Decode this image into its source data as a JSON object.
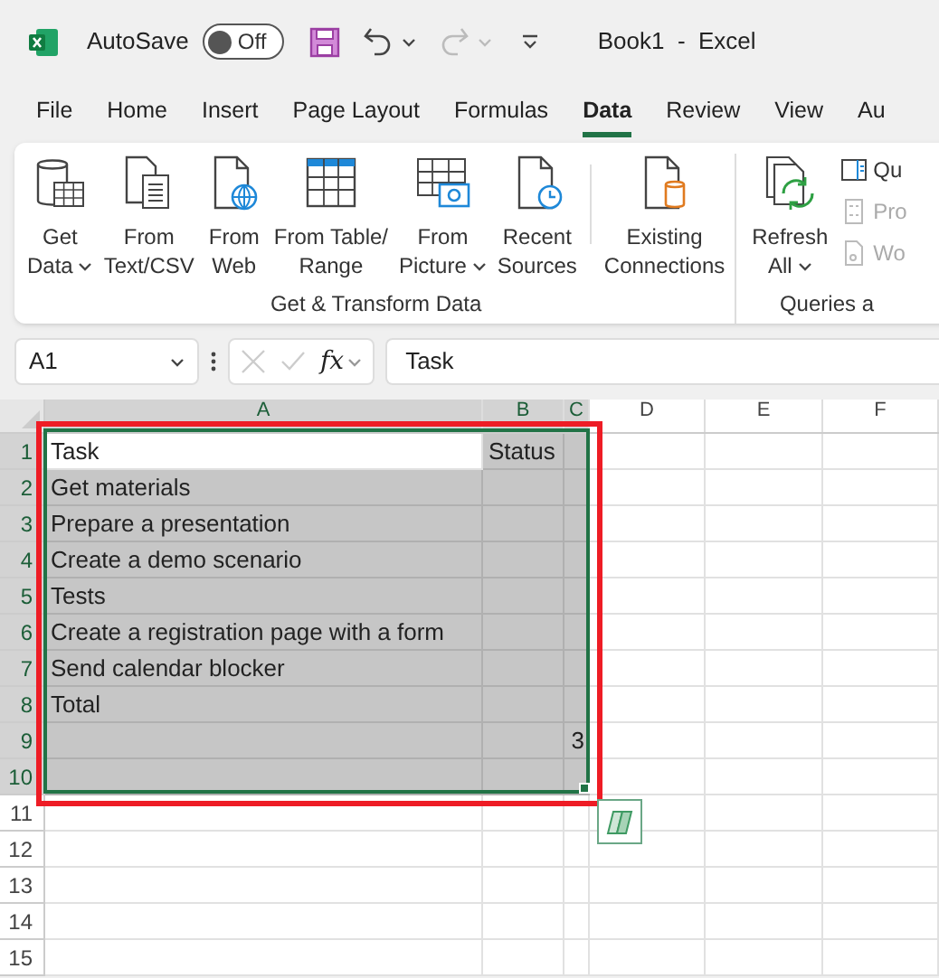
{
  "title_bar": {
    "autosave_label": "AutoSave",
    "autosave_toggle": {
      "label": "Off",
      "on": false
    },
    "title": "Book1  -  Excel"
  },
  "tabs": [
    {
      "label": "File",
      "selected": false
    },
    {
      "label": "Home",
      "selected": false
    },
    {
      "label": "Insert",
      "selected": false
    },
    {
      "label": "Page Layout",
      "selected": false
    },
    {
      "label": "Formulas",
      "selected": false
    },
    {
      "label": "Data",
      "selected": true
    },
    {
      "label": "Review",
      "selected": false
    },
    {
      "label": "View",
      "selected": false
    },
    {
      "label": "Au",
      "selected": false
    }
  ],
  "ribbon": {
    "groups": [
      {
        "label": "Get & Transform Data",
        "buttons": [
          {
            "kind": "get-data",
            "lines": [
              "Get",
              "Data"
            ],
            "dropdown": true
          },
          {
            "kind": "text-csv",
            "lines": [
              "From",
              "Text/CSV"
            ],
            "dropdown": false
          },
          {
            "kind": "web",
            "lines": [
              "From",
              "Web"
            ],
            "dropdown": false
          },
          {
            "kind": "table",
            "lines": [
              "From Table/",
              "Range"
            ],
            "dropdown": false
          },
          {
            "kind": "picture",
            "lines": [
              "From",
              "Picture"
            ],
            "dropdown": true
          },
          {
            "kind": "recent",
            "lines": [
              "Recent",
              "Sources"
            ],
            "dropdown": false
          },
          {
            "kind": "connections",
            "lines": [
              "Existing",
              "Connections"
            ],
            "dropdown": false
          }
        ]
      },
      {
        "label": "Queries a",
        "buttons": [
          {
            "kind": "refresh",
            "lines": [
              "Refresh",
              "All"
            ],
            "dropdown": true
          }
        ],
        "small_items": [
          {
            "kind": "queries",
            "label": "Qu",
            "disabled": false
          },
          {
            "kind": "properties",
            "label": "Pro",
            "disabled": true
          },
          {
            "kind": "links",
            "label": "Wo",
            "disabled": true
          }
        ]
      }
    ]
  },
  "formula_bar": {
    "name_box": "A1",
    "fx": "fx",
    "value": "Task"
  },
  "sheet": {
    "columns": [
      {
        "label": "A",
        "selected": true
      },
      {
        "label": "B",
        "selected": true
      },
      {
        "label": "C",
        "selected": true
      },
      {
        "label": "D",
        "selected": false
      },
      {
        "label": "E",
        "selected": false
      },
      {
        "label": "F",
        "selected": false
      }
    ],
    "rows": [
      {
        "number": "1",
        "selected": true,
        "cells": [
          {
            "text": "Task",
            "active": true
          },
          {
            "text": "Status"
          },
          {}
        ]
      },
      {
        "number": "2",
        "selected": true,
        "cells": [
          {
            "text": "Get materials"
          },
          {},
          {}
        ]
      },
      {
        "number": "3",
        "selected": true,
        "cells": [
          {
            "text": "Prepare a presentation"
          },
          {},
          {}
        ]
      },
      {
        "number": "4",
        "selected": true,
        "cells": [
          {
            "text": "Create a demo scenario"
          },
          {},
          {}
        ]
      },
      {
        "number": "5",
        "selected": true,
        "cells": [
          {
            "text": "Tests"
          },
          {},
          {}
        ]
      },
      {
        "number": "6",
        "selected": true,
        "cells": [
          {
            "text": "Create a registration page with a form"
          },
          {},
          {}
        ]
      },
      {
        "number": "7",
        "selected": true,
        "cells": [
          {
            "text": "Send calendar blocker"
          },
          {},
          {}
        ]
      },
      {
        "number": "8",
        "selected": true,
        "cells": [
          {
            "text": "Total"
          },
          {},
          {}
        ]
      },
      {
        "number": "9",
        "selected": true,
        "cells": [
          {},
          {},
          {
            "text": "3",
            "kind": "number"
          }
        ]
      },
      {
        "number": "10",
        "selected": true,
        "cells": [
          {},
          {},
          {}
        ]
      },
      {
        "number": "11",
        "selected": false,
        "cells": []
      },
      {
        "number": "12",
        "selected": false,
        "cells": []
      },
      {
        "number": "13",
        "selected": false,
        "cells": []
      },
      {
        "number": "14",
        "selected": false,
        "cells": []
      },
      {
        "number": "15",
        "selected": false,
        "cells": []
      }
    ]
  }
}
